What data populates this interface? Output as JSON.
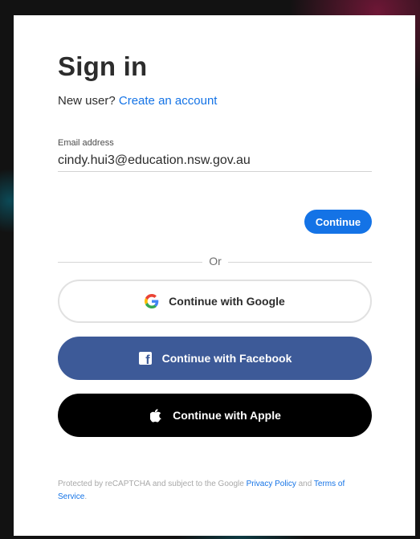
{
  "signin": {
    "title": "Sign in",
    "new_user_prefix": "New user?",
    "create_account_link": "Create an account"
  },
  "email": {
    "label": "Email address",
    "value": "cindy.hui3@education.nsw.gov.au"
  },
  "continue_label": "Continue",
  "divider_text": "Or",
  "social": {
    "google_label": "Continue with Google",
    "facebook_label": "Continue with Facebook",
    "apple_label": "Continue with Apple"
  },
  "footer": {
    "text_prefix": "Protected by reCAPTCHA and subject to the Google",
    "privacy_link": "Privacy Policy",
    "and_text": "and",
    "terms_link": "Terms of Service",
    "end_punct": "."
  },
  "colors": {
    "accent_blue": "#1473e6",
    "facebook_blue": "#3d5a98",
    "apple_black": "#000000"
  },
  "icons": {
    "google": "google-g-icon",
    "facebook": "facebook-f-icon",
    "apple": "apple-logo-icon"
  }
}
